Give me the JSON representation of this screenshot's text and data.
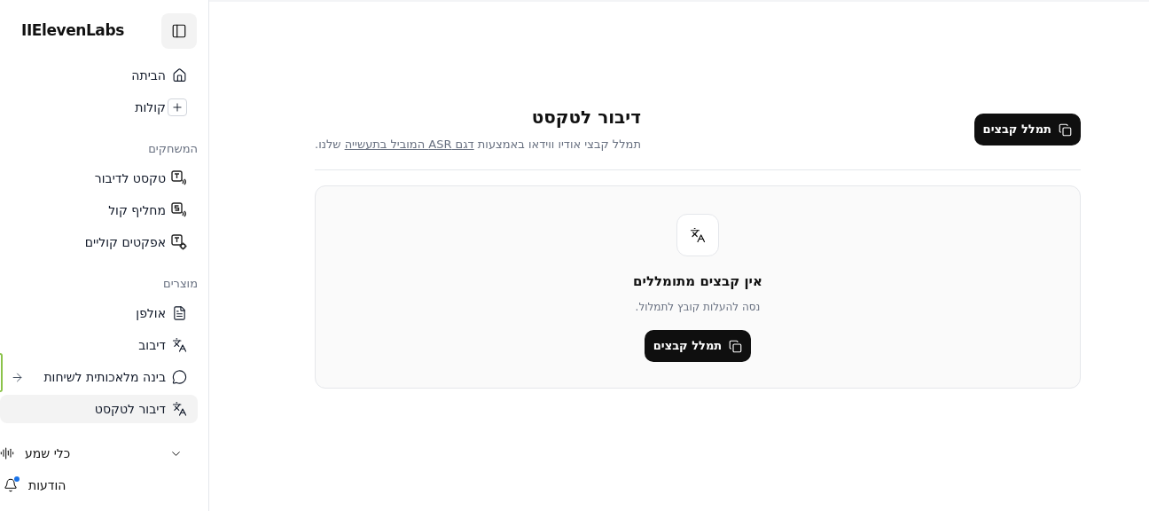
{
  "sidebar": {
    "logo": "IIElevenLabs",
    "items": [
      {
        "kind": "link",
        "label": "הביתה",
        "selected": false
      },
      {
        "kind": "link",
        "label": "קולות",
        "selected": false
      },
      {
        "kind": "section",
        "label": "המשחקים"
      },
      {
        "kind": "link",
        "label": "טקסט לדיבור",
        "selected": false
      },
      {
        "kind": "link",
        "label": "מחליף קול",
        "selected": false
      },
      {
        "kind": "link",
        "label": "אפקטים קוליים",
        "selected": false
      },
      {
        "kind": "section",
        "label": "מוצרים"
      },
      {
        "kind": "link",
        "label": "אולפן",
        "selected": false
      },
      {
        "kind": "link",
        "label": "דיבוב",
        "selected": false
      },
      {
        "kind": "external",
        "label": "בינה מלאכותית לשיחות",
        "selected": false
      },
      {
        "kind": "link",
        "label": "דיבור לטקסט",
        "selected": true
      }
    ],
    "footer": [
      {
        "kind": "group",
        "label": "כלי שמע",
        "expanded": false
      },
      {
        "kind": "notifications",
        "label": "הודעות",
        "unread": true
      }
    ]
  },
  "header": {
    "title": "דיבור לטקסט",
    "subtitle_before": "תמלל קבצי אודיו ווידאו באמצעות",
    "subtitle_link": "דגם ASR המוביל בתעשייה",
    "subtitle_after": "שלנו.",
    "button": "תמלל קבצים"
  },
  "empty_state": {
    "title": "אין קבצים מתומללים",
    "message": "נסה להעלות קובץ לתמלול.",
    "button": "תמלל קבצים"
  }
}
